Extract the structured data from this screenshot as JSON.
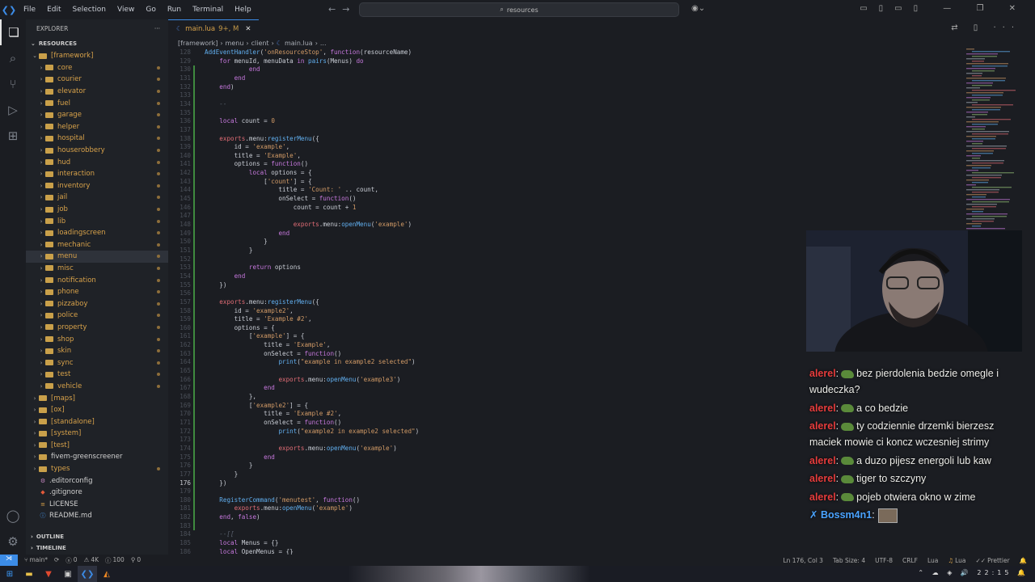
{
  "menubar": [
    "File",
    "Edit",
    "Selection",
    "View",
    "Go",
    "Run",
    "Terminal",
    "Help"
  ],
  "search": {
    "text": "resources"
  },
  "sidebar": {
    "title": "EXPLORER",
    "section": "RESOURCES",
    "items": [
      {
        "label": "[framework]",
        "type": "folder",
        "open": true,
        "depth": 1
      },
      {
        "label": "core",
        "type": "folder",
        "depth": 2
      },
      {
        "label": "courier",
        "type": "folder",
        "depth": 2
      },
      {
        "label": "elevator",
        "type": "folder",
        "depth": 2
      },
      {
        "label": "fuel",
        "type": "folder",
        "depth": 2
      },
      {
        "label": "garage",
        "type": "folder",
        "depth": 2
      },
      {
        "label": "helper",
        "type": "folder",
        "depth": 2
      },
      {
        "label": "hospital",
        "type": "folder",
        "depth": 2
      },
      {
        "label": "houserobbery",
        "type": "folder",
        "depth": 2
      },
      {
        "label": "hud",
        "type": "folder",
        "depth": 2
      },
      {
        "label": "interaction",
        "type": "folder",
        "depth": 2
      },
      {
        "label": "inventory",
        "type": "folder",
        "depth": 2
      },
      {
        "label": "jail",
        "type": "folder",
        "depth": 2
      },
      {
        "label": "job",
        "type": "folder",
        "depth": 2
      },
      {
        "label": "lib",
        "type": "folder",
        "depth": 2
      },
      {
        "label": "loadingscreen",
        "type": "folder",
        "depth": 2
      },
      {
        "label": "mechanic",
        "type": "folder",
        "depth": 2
      },
      {
        "label": "menu",
        "type": "folder",
        "depth": 2,
        "selected": true
      },
      {
        "label": "misc",
        "type": "folder",
        "depth": 2
      },
      {
        "label": "notification",
        "type": "folder",
        "depth": 2
      },
      {
        "label": "phone",
        "type": "folder",
        "depth": 2
      },
      {
        "label": "pizzaboy",
        "type": "folder",
        "depth": 2
      },
      {
        "label": "police",
        "type": "folder",
        "depth": 2
      },
      {
        "label": "property",
        "type": "folder",
        "depth": 2
      },
      {
        "label": "shop",
        "type": "folder",
        "depth": 2
      },
      {
        "label": "skin",
        "type": "folder",
        "depth": 2
      },
      {
        "label": "sync",
        "type": "folder",
        "depth": 2
      },
      {
        "label": "test",
        "type": "folder",
        "depth": 2
      },
      {
        "label": "vehicle",
        "type": "folder",
        "depth": 2
      },
      {
        "label": "[maps]",
        "type": "folder",
        "depth": 1
      },
      {
        "label": "[ox]",
        "type": "folder",
        "depth": 1
      },
      {
        "label": "[standalone]",
        "type": "folder",
        "depth": 1
      },
      {
        "label": "[system]",
        "type": "folder",
        "depth": 1
      },
      {
        "label": "[test]",
        "type": "folder",
        "depth": 1
      },
      {
        "label": "fivem-greenscreener",
        "type": "folder",
        "depth": 1,
        "plain": true
      },
      {
        "label": "types",
        "type": "folder",
        "depth": 1
      },
      {
        "label": ".editorconfig",
        "type": "file",
        "depth": 1,
        "icon": "gear-icon"
      },
      {
        "label": ".gitignore",
        "type": "file",
        "depth": 1,
        "icon": "git-icon"
      },
      {
        "label": "LICENSE",
        "type": "file",
        "depth": 1,
        "icon": "license-icon"
      },
      {
        "label": "README.md",
        "type": "file",
        "depth": 1,
        "icon": "info-icon"
      }
    ],
    "outline": "OUTLINE",
    "timeline": "TIMELINE"
  },
  "tab": {
    "label": "main.lua",
    "badge": "9+, M"
  },
  "breadcrumb": {
    "parts": [
      "[framework]",
      "menu",
      "client",
      "main.lua",
      "..."
    ]
  },
  "code": {
    "lines": [
      {
        "n": "128",
        "t": "AddEventHandler('onResourceStop', function(resourceName)"
      },
      {
        "n": "",
        "t": "    for menuId, menuData in pairs(Menus) do"
      },
      {
        "n": "",
        "t": "            end"
      },
      {
        "n": "",
        "t": "        end"
      },
      {
        "n": "",
        "t": "    end)"
      },
      {
        "n": "",
        "t": ""
      },
      {
        "n": "",
        "t": "    --"
      },
      {
        "n": "",
        "t": ""
      },
      {
        "n": "",
        "t": "    local count = 0"
      },
      {
        "n": "",
        "t": ""
      },
      {
        "n": "",
        "t": "    exports.menu:registerMenu({"
      },
      {
        "n": "",
        "t": "        id = 'example',"
      },
      {
        "n": "",
        "t": "        title = 'Example',"
      },
      {
        "n": "",
        "t": "        options = function()"
      },
      {
        "n": "",
        "t": "            local options = {"
      },
      {
        "n": "",
        "t": "                ['count'] = {"
      },
      {
        "n": "",
        "t": "                    title = 'Count: ' .. count,"
      },
      {
        "n": "",
        "t": "                    onSelect = function()"
      },
      {
        "n": "",
        "t": "                        count = count + 1"
      },
      {
        "n": "",
        "t": ""
      },
      {
        "n": "",
        "t": "                        exports.menu:openMenu('example')"
      },
      {
        "n": "",
        "t": "                    end"
      },
      {
        "n": "",
        "t": "                }"
      },
      {
        "n": "",
        "t": "            }"
      },
      {
        "n": "",
        "t": ""
      },
      {
        "n": "",
        "t": "            return options"
      },
      {
        "n": "",
        "t": "        end"
      },
      {
        "n": "",
        "t": "    })"
      },
      {
        "n": "",
        "t": ""
      },
      {
        "n": "",
        "t": "    exports.menu:registerMenu({"
      },
      {
        "n": "",
        "t": "        id = 'example2',"
      },
      {
        "n": "",
        "t": "        title = 'Example #2',"
      },
      {
        "n": "",
        "t": "        options = {"
      },
      {
        "n": "",
        "t": "            ['example'] = {"
      },
      {
        "n": "",
        "t": "                title = 'Example',"
      },
      {
        "n": "",
        "t": "                onSelect = function()"
      },
      {
        "n": "",
        "t": "                    print(\"example in example2 selected\")"
      },
      {
        "n": "",
        "t": ""
      },
      {
        "n": "",
        "t": "                    exports.menu:openMenu('example3')"
      },
      {
        "n": "",
        "t": "                end"
      },
      {
        "n": "",
        "t": "            },"
      },
      {
        "n": "",
        "t": "            ['example2'] = {"
      },
      {
        "n": "",
        "t": "                title = 'Example #2',"
      },
      {
        "n": "",
        "t": "                onSelect = function()"
      },
      {
        "n": "",
        "t": "                    print(\"example2 in example2 selected\")"
      },
      {
        "n": "",
        "t": ""
      },
      {
        "n": "",
        "t": "                    exports.menu:openMenu('example')"
      },
      {
        "n": "",
        "t": "                end"
      },
      {
        "n": "",
        "t": "            }"
      },
      {
        "n": "",
        "t": "        }"
      },
      {
        "n": "176",
        "t": "    })"
      },
      {
        "n": "",
        "t": ""
      },
      {
        "n": "",
        "t": "    RegisterCommand('menutest', function()"
      },
      {
        "n": "",
        "t": "        exports.menu:openMenu('example')"
      },
      {
        "n": "",
        "t": "    end, false)"
      },
      {
        "n": "",
        "t": ""
      },
      {
        "n": "",
        "t": "    --[["
      },
      {
        "n": "",
        "t": "    local Menus = {}"
      },
      {
        "n": "",
        "t": "    local OpenMenus = {}"
      }
    ]
  },
  "status": {
    "branch": "main*",
    "errors": "0",
    "warnings": "4K",
    "info": "100",
    "ports": "0",
    "position": "Ln 176, Col 3",
    "tabsize": "Tab Size: 4",
    "encoding": "UTF-8",
    "eol": "CRLF",
    "language": "Lua",
    "lua": "Lua",
    "prettier": "Prettier"
  },
  "taskbar": {
    "time": "22:15"
  },
  "chat": [
    {
      "user": "alerel",
      "emote": true,
      "text": "bez pierdolenia bedzie omegle i wudeczka?"
    },
    {
      "user": "alerel",
      "emote": true,
      "text": "a co bedzie"
    },
    {
      "user": "alerel",
      "emote": true,
      "text": "ty codziennie drzemki bierzesz maciek mowie ci koncz wczesniej strimy"
    },
    {
      "user": "alerel",
      "emote": true,
      "text": "a duzo pijesz energoli lub kaw"
    },
    {
      "user": "alerel",
      "emote": true,
      "text": "tiger to szczyny"
    },
    {
      "user": "alerel",
      "emote": true,
      "text": "pojeb otwiera okno w zime"
    },
    {
      "user": "Bossm4n1",
      "emote": false,
      "text": ""
    }
  ]
}
